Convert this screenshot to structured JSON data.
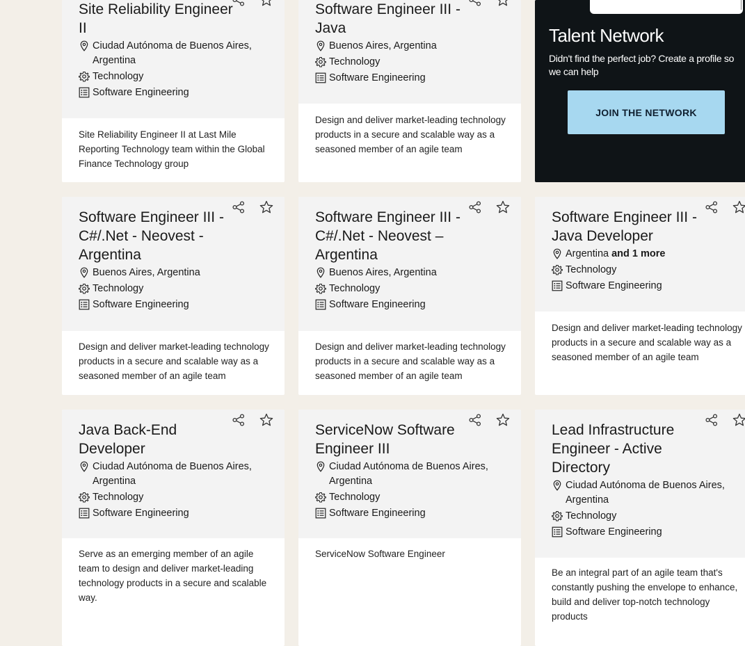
{
  "jobs": [
    {
      "title": "Site Reliability Engineer II",
      "location": "Ciudad Autónoma de Buenos Aires, Argentina",
      "location_more": "",
      "category": "Technology",
      "subcategory": "Software Engineering",
      "description": "Site Reliability Engineer II at Last Mile Reporting Technology team within the Global Finance Technology group"
    },
    {
      "title": "Software Engineer III - Java",
      "location": "Buenos Aires, Argentina",
      "location_more": "",
      "category": "Technology",
      "subcategory": "Software Engineering",
      "description": "Design and deliver market-leading technology products in a secure and scalable way as a seasoned member of an agile team"
    },
    {
      "title": "Software Engineer III - C#/.Net - Neovest - Argentina",
      "location": "Buenos Aires, Argentina",
      "location_more": "",
      "category": "Technology",
      "subcategory": "Software Engineering",
      "description": "Design and deliver market-leading technology products in a secure and scalable way as a seasoned member of an agile team"
    },
    {
      "title": "Software Engineer III - C#/.Net - Neovest – Argentina",
      "location": "Buenos Aires, Argentina",
      "location_more": "",
      "category": "Technology",
      "subcategory": "Software Engineering",
      "description": "Design and deliver market-leading technology products in a secure and scalable way as a seasoned member of an agile team"
    },
    {
      "title": "Software Engineer III - Java Developer",
      "location": "Argentina",
      "location_more": "and 1 more",
      "category": "Technology",
      "subcategory": "Software Engineering",
      "description": "Design and deliver market-leading technology products in a secure and scalable way as a seasoned member of an agile team"
    },
    {
      "title": "Java Back-End Developer",
      "location": "Ciudad Autónoma de Buenos Aires, Argentina",
      "location_more": "",
      "category": "Technology",
      "subcategory": "Software Engineering",
      "description": "Serve as an emerging member of an agile team to design and deliver market-leading technology products in a secure and scalable way."
    },
    {
      "title": "ServiceNow Software Engineer III",
      "location": "Ciudad Autónoma de Buenos Aires, Argentina",
      "location_more": "",
      "category": "Technology",
      "subcategory": "Software Engineering",
      "description": "ServiceNow Software Engineer"
    },
    {
      "title": "Lead Infrastructure Engineer - Active Directory",
      "location": "Ciudad Autónoma de Buenos Aires, Argentina",
      "location_more": "",
      "category": "Technology",
      "subcategory": "Software Engineering",
      "description": "Be an integral part of an agile team that's constantly pushing the envelope to enhance, build and deliver top-notch technology products"
    }
  ],
  "talent": {
    "title": "Talent Network",
    "text": "Didn't find the perfect job? Create a profile so we can help",
    "button": "JOIN THE NETWORK"
  },
  "icons": {
    "share": "share-icon",
    "favorite": "star-icon",
    "location": "location-pin-icon",
    "category": "gear-icon",
    "subcategory": "list-icon"
  },
  "colors": {
    "page_bg": "#f3efe8",
    "card_top": "#f3f3f3",
    "talent_bg": "#0f1417",
    "join_button": "#a7d8f0"
  }
}
